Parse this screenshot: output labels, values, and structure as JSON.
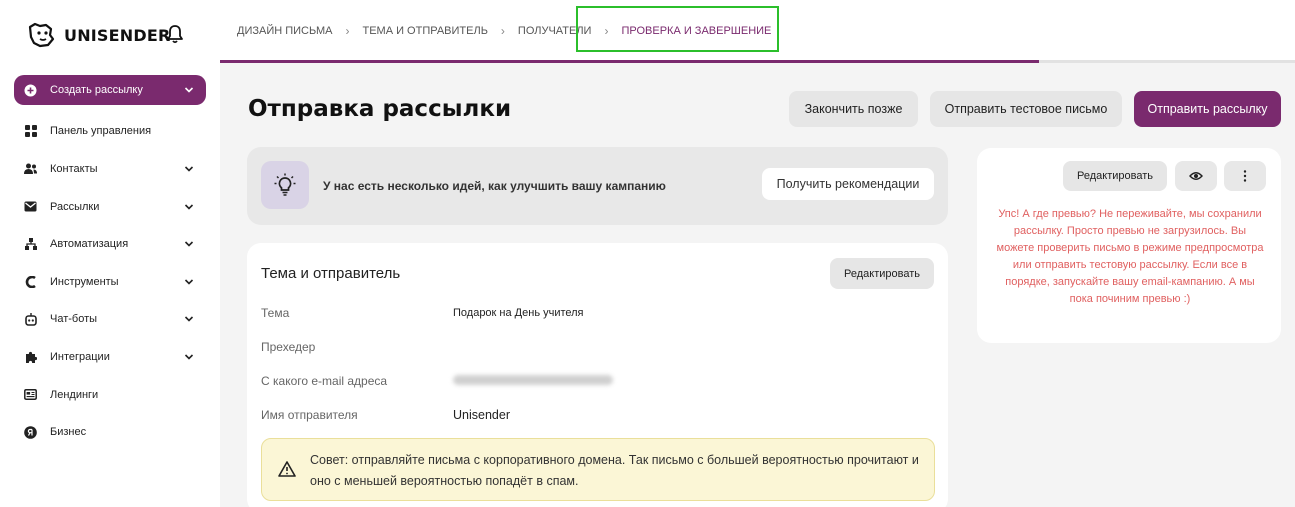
{
  "brand": {
    "name": "UNISENDER",
    "logo_icon": "dog-logo-icon",
    "bell_icon": "bell-icon"
  },
  "sidebar": {
    "items": [
      {
        "label": "Создать рассылку",
        "icon": "plus-circle-icon",
        "chevron": true,
        "active": true
      },
      {
        "label": "Панель управления",
        "icon": "grid-icon",
        "chevron": false
      },
      {
        "label": "Контакты",
        "icon": "users-icon",
        "chevron": true
      },
      {
        "label": "Рассылки",
        "icon": "mail-icon",
        "chevron": true
      },
      {
        "label": "Автоматизация",
        "icon": "flow-icon",
        "chevron": true
      },
      {
        "label": "Инструменты",
        "icon": "tools-icon",
        "chevron": true
      },
      {
        "label": "Чат-боты",
        "icon": "bot-icon",
        "chevron": true
      },
      {
        "label": "Интеграции",
        "icon": "puzzle-icon",
        "chevron": true
      },
      {
        "label": "Лендинги",
        "icon": "landing-icon",
        "chevron": false
      },
      {
        "label": "Бизнес",
        "icon": "business-icon",
        "chevron": false
      }
    ]
  },
  "steps": [
    {
      "label": "Дизайн письма"
    },
    {
      "label": "Тема и отправитель"
    },
    {
      "label": "Получатели"
    },
    {
      "label": "Проверка и завершение",
      "current": true
    }
  ],
  "progress": {
    "fraction": 0.762
  },
  "page": {
    "title": "Отправка рассылки",
    "finish_later": "Закончить позже",
    "send_test": "Отправить тестовое письмо",
    "send": "Отправить рассылку"
  },
  "ideas": {
    "text": "У нас есть несколько идей, как улучшить вашу кампанию",
    "button": "Получить рекомендации"
  },
  "sender": {
    "title": "Тема и отправитель",
    "edit": "Редактировать",
    "fields": [
      {
        "label": "Тема",
        "value": "Подарок на День учителя"
      },
      {
        "label": "Прехедер",
        "value": ""
      },
      {
        "label": "С какого e-mail адреса",
        "value": ""
      },
      {
        "label": "Имя отправителя",
        "value": "Unisender"
      }
    ],
    "tip": "Совет: отправляйте письма с корпоративного домена. Так письмо с большей вероятностью прочитают и оно с меньшей вероятностью попадёт в спам."
  },
  "preview": {
    "edit": "Редактировать",
    "message": "Упс! А где превью? Не переживайте, мы сохранили рассылку. Просто превью не загрузилось. Вы можете проверить письмо в режиме предпросмотра или отправить тестовую рассылку. Если все в порядке, запускайте вашу email-кампанию. А мы пока починим превью :)"
  },
  "colors": {
    "brand": "#7a2a6e",
    "highlight": "#2bbf2b",
    "error_text": "#e06060"
  }
}
